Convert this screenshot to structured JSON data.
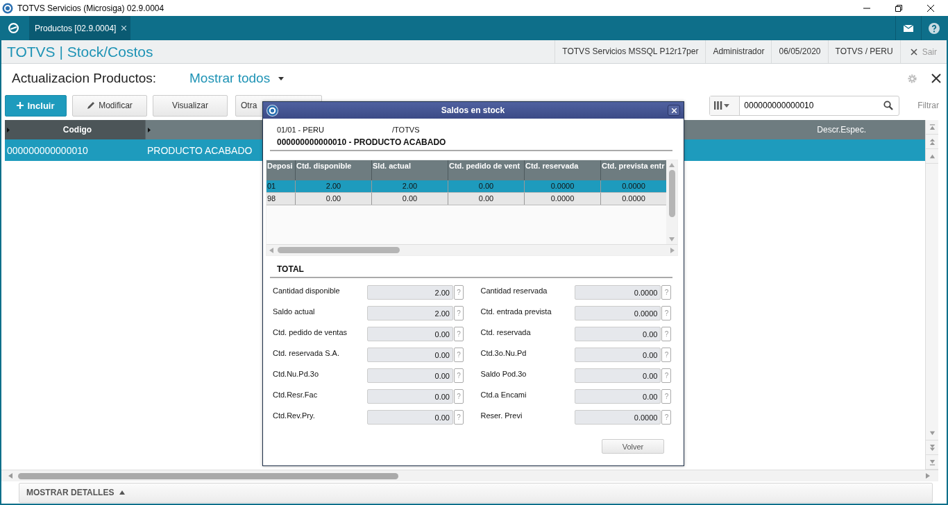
{
  "window": {
    "title": "TOTVS Servicios (Microsiga) 02.9.0004"
  },
  "tabs": [
    {
      "label": "Productos [02.9.0004]",
      "selected": true
    }
  ],
  "app_header": {
    "title": "TOTVS | Stock/Costos",
    "info": [
      "TOTVS Servicios MSSQL P12r17per",
      "Administrador",
      "06/05/2020",
      "TOTVS / PERU"
    ],
    "exit": "Sair"
  },
  "page": {
    "title": "Actualizacion Productos:",
    "view": "Mostrar todos"
  },
  "toolbar": [
    {
      "label": "Incluir",
      "kind": "primary"
    },
    {
      "label": "Modificar",
      "kind": "edit"
    },
    {
      "label": "Visualizar",
      "kind": "plain"
    },
    {
      "label": "Otra",
      "kind": "more"
    }
  ],
  "search": {
    "value": "000000000000010",
    "filter": "Filtrar"
  },
  "grid": {
    "columns": [
      {
        "label": "Codigo",
        "kind": "key"
      },
      {
        "kind": "text"
      },
      {
        "label": "Descr.Espec.",
        "kind": "text"
      }
    ],
    "rows": [
      {
        "cells": [
          "000000000000010",
          "PRODUCTO ACABADO"
        ],
        "selected": true
      }
    ]
  },
  "dialog": {
    "title": "Saldos en stock",
    "branch": "01/01 - PERU",
    "company": "/TOTVS",
    "product": "000000000000010 - PRODUCTO ACABADO",
    "columns": [
      "Deposi",
      "Ctd. disponible",
      "Sld. actual",
      "Ctd. pedido de vent",
      "Ctd. reservada",
      "Ctd. prevista entr"
    ],
    "rows": [
      {
        "cells": [
          "01",
          "2.00",
          "2.00",
          "0.00",
          "0.0000",
          "0.0000"
        ],
        "selected": true
      },
      {
        "cells": [
          "98",
          "0.00",
          "0.00",
          "0.00",
          "0.0000",
          "0.0000"
        ],
        "selected": false
      }
    ],
    "total_heading": "TOTAL",
    "fields": [
      [
        {
          "label": "Cantidad disponible",
          "value": "2.00"
        },
        {
          "label": "Cantidad reservada",
          "value": "0.0000"
        }
      ],
      [
        {
          "label": "Saldo actual",
          "value": "2.00"
        },
        {
          "label": "Ctd. entrada prevista",
          "value": "0.0000"
        }
      ],
      [
        {
          "label": "Ctd. pedido de ventas",
          "value": "0.00"
        },
        {
          "label": "Ctd. reservada",
          "value": "0.00"
        }
      ],
      [
        {
          "label": "Ctd. reservada S.A.",
          "value": "0.00"
        },
        {
          "label": "Ctd.3o.Nu.Pd",
          "value": "0.00"
        }
      ],
      [
        {
          "label": "Ctd.Nu.Pd.3o",
          "value": "0.00"
        },
        {
          "label": "Saldo Pod.3o",
          "value": "0.00"
        }
      ],
      [
        {
          "label": "Ctd.Resr.Fac",
          "value": "0.00"
        },
        {
          "label": "Ctd.a Encami",
          "value": "0.00"
        }
      ],
      [
        {
          "label": "Ctd.Rev.Pry.",
          "value": "0.00"
        },
        {
          "label": "Reser. Previ",
          "value": "0.0000"
        }
      ]
    ],
    "help": "?",
    "button": "Volver"
  },
  "footer": {
    "label": "MOSTRAR DETALLES"
  }
}
